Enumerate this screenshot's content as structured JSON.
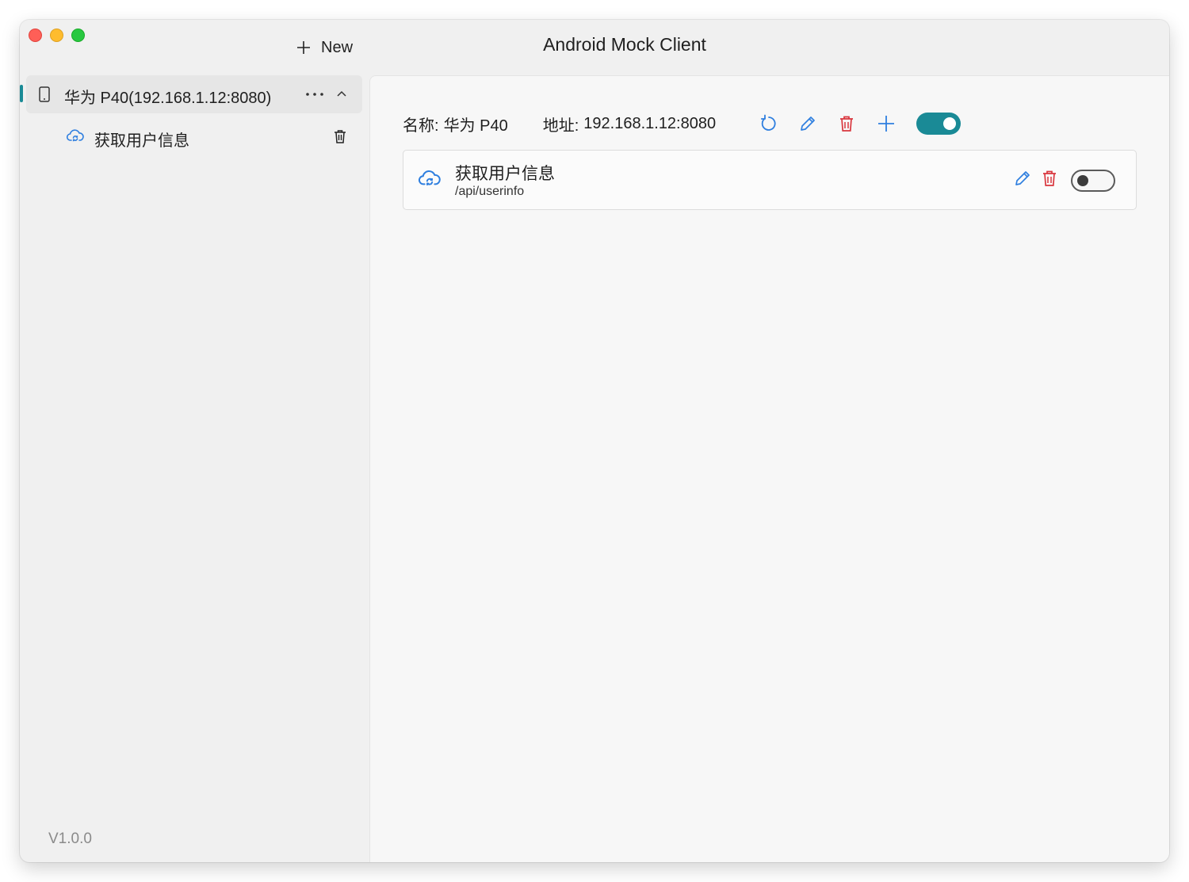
{
  "window": {
    "title": "Android Mock Client",
    "new_button_label": "New"
  },
  "sidebar": {
    "device": {
      "label": "华为 P40(192.168.1.12:8080)",
      "icon": "phone-icon"
    },
    "apis": [
      {
        "label": "获取用户信息",
        "icon": "cloud-sync-icon"
      }
    ],
    "version": "V1.0.0"
  },
  "main": {
    "name_label": "名称:",
    "name_value": "华为 P40",
    "address_label": "地址:",
    "address_value": "192.168.1.12:8080",
    "device_enabled": true,
    "api_cards": [
      {
        "title": "获取用户信息",
        "path": "/api/userinfo",
        "enabled": false
      }
    ]
  },
  "colors": {
    "accent": "#1a8a96",
    "icon_blue": "#2f7fdf",
    "delete_red": "#d9363e"
  }
}
